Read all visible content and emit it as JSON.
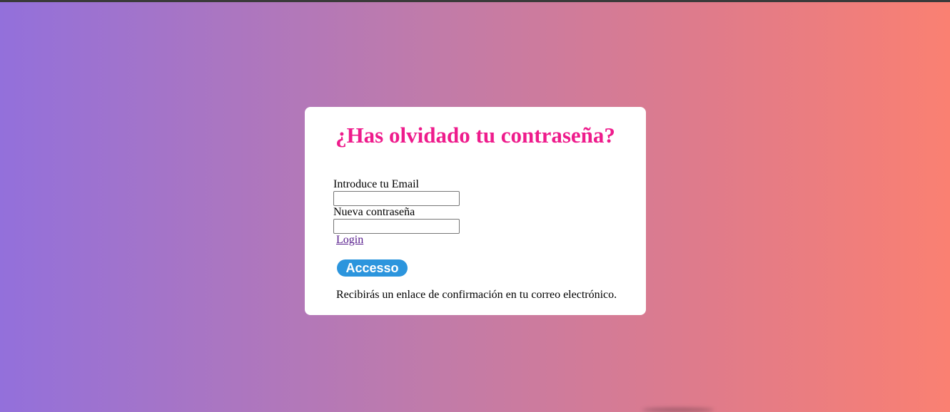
{
  "page": {
    "background_gradient": [
      "#9370DB",
      "#FA8072"
    ]
  },
  "card": {
    "title": "¿Has olvidado tu contraseña?",
    "title_color": "#EE1C8C",
    "email_label": "Introduce tu Email",
    "email_value": "",
    "password_label": "Nueva contraseña",
    "password_value": "",
    "login_link": "Login",
    "submit_button": "Accesso",
    "submit_color": "#2C95DD",
    "help_text": "Recibirás un enlace de confirmación en tu correo electrónico."
  }
}
